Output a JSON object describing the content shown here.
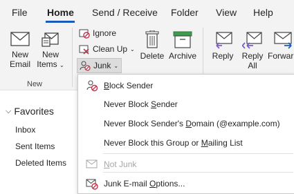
{
  "tabs": [
    "File",
    "Home",
    "Send / Receive",
    "Folder",
    "View",
    "Help"
  ],
  "active_tab": "Home",
  "ribbon": {
    "new_email": [
      "New",
      "Email"
    ],
    "new_items": [
      "New",
      "Items"
    ],
    "group_new": "New",
    "ignore": "Ignore",
    "clean_up": "Clean Up",
    "junk": "Junk",
    "delete": "Delete",
    "archive": "Archive",
    "reply": "Reply",
    "reply_all": [
      "Reply",
      "All"
    ],
    "forward": "Forwar"
  },
  "nav": {
    "favorites": "Favorites",
    "items": [
      "Inbox",
      "Sent Items",
      "Deleted Items"
    ]
  },
  "junk_menu": {
    "items": [
      {
        "label": "Block Sender",
        "accel": "B",
        "rest": "lock Sender"
      },
      {
        "label": "Never Block Sender",
        "pre": "Never Block ",
        "accel": "S",
        "rest": "ender"
      },
      {
        "label": "Never Block Sender's Domain (@example.com)",
        "pre": "Never Block Sender's ",
        "accel": "D",
        "rest": "omain (@example.com)"
      },
      {
        "label": "Never Block this Group or Mailing List",
        "pre": "Never Block this Group or ",
        "accel": "M",
        "rest": "ailing List"
      },
      {
        "label": "Not Junk",
        "accel": "N",
        "rest": "ot Junk"
      },
      {
        "label": "Junk E-mail Options...",
        "pre": "Junk E-mail ",
        "accel": "O",
        "rest": "ptions..."
      }
    ]
  },
  "colors": {
    "accent": "#185abd",
    "block_red": "#c4314b",
    "reply_purple": "#7d5ac8",
    "archive_green": "#3f9b4d"
  }
}
